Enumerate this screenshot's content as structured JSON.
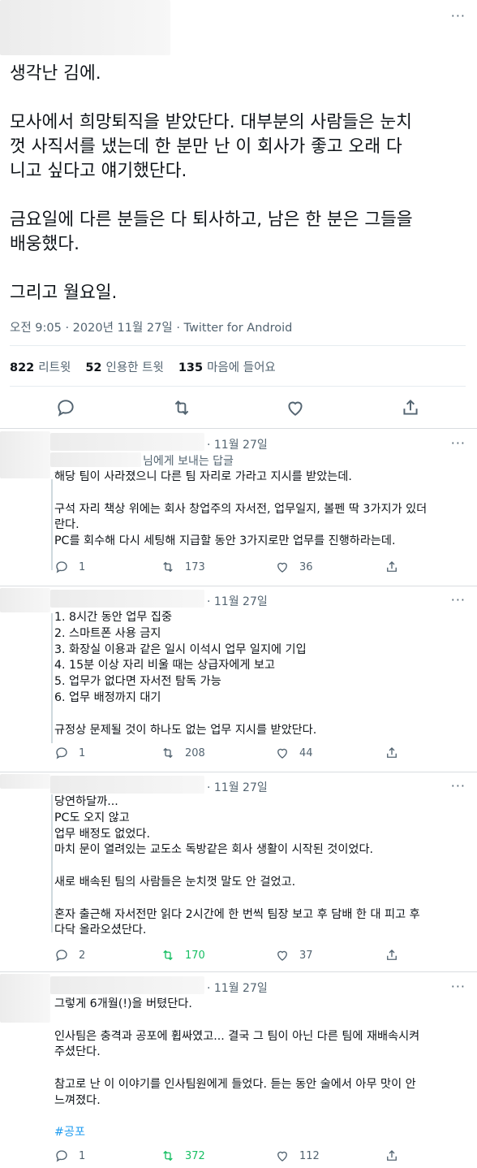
{
  "main_tweet": {
    "paragraphs": [
      "생각난 김에.",
      "모사에서 희망퇴직을 받았단다. 대부분의 사람들은 눈치\n껏 사직서를 냈는데 한 분만 난 이 회사가 좋고 오래 다\n니고 싶다고 얘기했단다.",
      "금요일에 다른 분들은 다 퇴사하고, 남은 한 분은 그들을\n배웅했다.",
      "그리고 월요일."
    ],
    "meta": "오전 9:05 · 2020년 11월 27일 · Twitter for Android",
    "stats": [
      {
        "count": "822",
        "label": "리트윗"
      },
      {
        "count": "52",
        "label": "인용한 트윗"
      },
      {
        "count": "135",
        "label": "마음에 들어요"
      }
    ],
    "icons": [
      "reply-icon",
      "retweet-icon",
      "like-icon",
      "share-icon"
    ]
  },
  "more_label": "···",
  "replies": [
    {
      "date": "· 11월 27일",
      "reply_to": "님에게 보내는 답글",
      "lines": [
        "해당 팀이 사라졌으니 다른 팀 자리로 가라고 지시를 받았는데.",
        "",
        "구석 자리 책상 위에는 회사 창업주의 자서전, 업무일지, 볼펜 딱 3가지가 있더",
        "란다.",
        "PC를 회수해 다시 세팅해 지급할 동안 3가지로만 업무를 진행하라는데."
      ],
      "replies": "1",
      "retweets": "173",
      "likes": "36",
      "retweet_color": "#536471"
    },
    {
      "date": "· 11월 27일",
      "lines": [
        "1. 8시간 동안 업무 집중",
        "2. 스마트폰 사용 금지",
        "3. 화장실 이용과 같은 일시 이석시 업무 일지에 기입",
        "4. 15분 이상 자리 비울 때는 상급자에게 보고",
        "5. 업무가 없다면 자서전 탐독 가능",
        "6. 업무 배정까지 대기",
        "",
        "규정상 문제될 것이 하나도 없는 업무 지시를 받았단다."
      ],
      "replies": "1",
      "retweets": "208",
      "likes": "44",
      "retweet_color": "#536471"
    },
    {
      "date": "· 11월 27일",
      "lines": [
        "당연하달까...",
        "PC도 오지 않고",
        "업무 배정도 없었다.",
        "마치 문이 열려있는 교도소 독방같은 회사 생활이 시작된 것이었다.",
        "",
        "새로 배속된 팀의 사람들은 눈치껏 말도 안 걸었고.",
        "",
        "혼자 출근해 자서전만 읽다 2시간에 한 번씩 팀장 보고 후 담배 한 대 피고 후",
        "다닥 올라오셨단다."
      ],
      "replies": "2",
      "retweets": "170",
      "likes": "37",
      "retweet_color": "#17bf63"
    },
    {
      "date": "· 11월 27일",
      "lines": [
        "그렇게 6개월(!)을 버텼단다.",
        "",
        "인사팀은 충격과 공포에 휩싸였고... 결국 그 팀이 아닌 다른 팀에 재배속시켜",
        "주셨단다.",
        "",
        "참고로 난 이 이야기를 인사팀원에게 들었다. 듣는 동안 술에서 아무 맛이 안",
        "느껴졌다.",
        ""
      ],
      "hashtag": "#공포",
      "replies": "1",
      "retweets": "372",
      "likes": "112",
      "retweet_color": "#17bf63"
    }
  ]
}
